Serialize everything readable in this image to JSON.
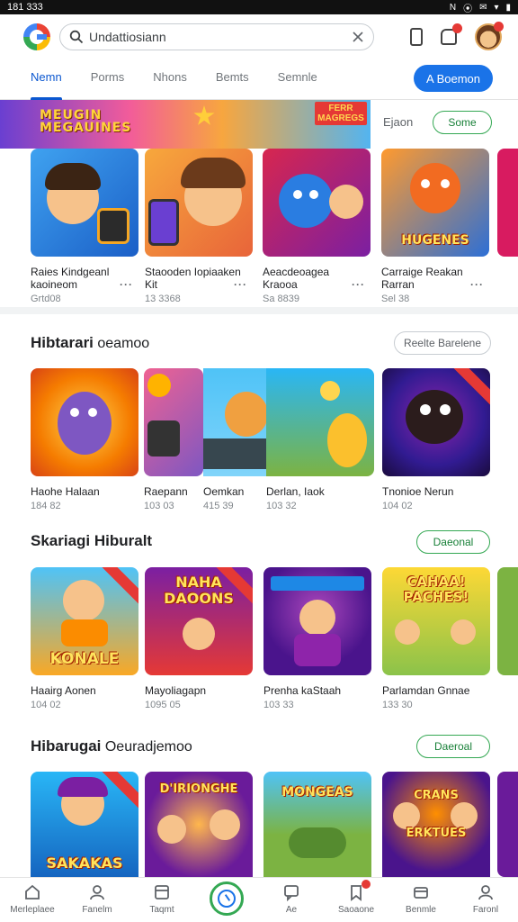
{
  "status_bar": {
    "time": "181 333",
    "icons": [
      "N",
      "⦿",
      "✉",
      "▾",
      "▮"
    ]
  },
  "search": {
    "value": "Undattiosiann"
  },
  "tabs": [
    {
      "label": "Nemn",
      "active": true
    },
    {
      "label": "Porms"
    },
    {
      "label": "Nhons"
    },
    {
      "label": "Bemts"
    },
    {
      "label": "Semnle"
    }
  ],
  "primary_button": "A Boemon",
  "featured": {
    "banner_title": "MEUGIN\nMEGAUINES",
    "banner_badge": "FERR\nMAGREGS",
    "link": "Ejaon",
    "button": "Some",
    "cards": [
      {
        "title": "Raies Kindgeanl",
        "sub": "kaoineom",
        "meta": "Grtd08"
      },
      {
        "title": "Staooden Iopiaaken",
        "sub": "Kit",
        "meta": "13 3368"
      },
      {
        "title": "Aeacdeoagea",
        "sub": "Kraooa",
        "meta": "Sa 8839"
      },
      {
        "title": "Carraige Reakan",
        "sub": "Rarran",
        "meta": "Sel 38"
      }
    ],
    "art_texts": [
      "",
      "",
      "",
      "HUGENES"
    ]
  },
  "sections": [
    {
      "title_strong": "Hibtarari",
      "title_rest": "oeamoo",
      "button": "Reelte Barelene",
      "cards": [
        {
          "title": "Haohe Halaan",
          "meta": "184 82"
        },
        {
          "title": "Raepann",
          "meta": "103 03"
        },
        {
          "title": "Oemkan",
          "meta": "415 39"
        },
        {
          "title": "Derlan, Iaok",
          "meta": "103 32"
        },
        {
          "title": "Tnonioe Nerun",
          "meta": "104 02"
        }
      ]
    },
    {
      "title_strong": "Skariagi Hiburalt",
      "title_rest": "",
      "button": "Daeonal",
      "cards": [
        {
          "title": "Haairg Aonen",
          "meta": "104 02",
          "art": "KONALE"
        },
        {
          "title": "Mayoliagapn",
          "meta": "1095 05",
          "art": "NAHA\nDAOONS"
        },
        {
          "title": "Prenha kaStaah",
          "meta": "103 33",
          "art": ""
        },
        {
          "title": "Parlamdan Gnnae",
          "meta": "133 30",
          "art": "CAHAA!\nPACHES!"
        }
      ]
    },
    {
      "title_strong": "Hibarugai",
      "title_rest": "Oeuradjemoo",
      "button": "Daeroal",
      "cards": [
        {
          "art": "SAKAKAS"
        },
        {
          "art": "D'IRIONGHE"
        },
        {
          "art": "MONGEAS"
        },
        {
          "art": "CRANS\nERKTUES"
        }
      ]
    }
  ],
  "bottom_nav": [
    {
      "label": "Merleplaee"
    },
    {
      "label": "Fanelm"
    },
    {
      "label": "Taqmt"
    },
    {
      "label": ""
    },
    {
      "label": "Ae"
    },
    {
      "label": "Saoaone"
    },
    {
      "label": "Benmle"
    },
    {
      "label": "Faronl"
    }
  ],
  "colors": {
    "accent": "#1a73e8",
    "green": "#34a853",
    "red": "#e53935"
  }
}
